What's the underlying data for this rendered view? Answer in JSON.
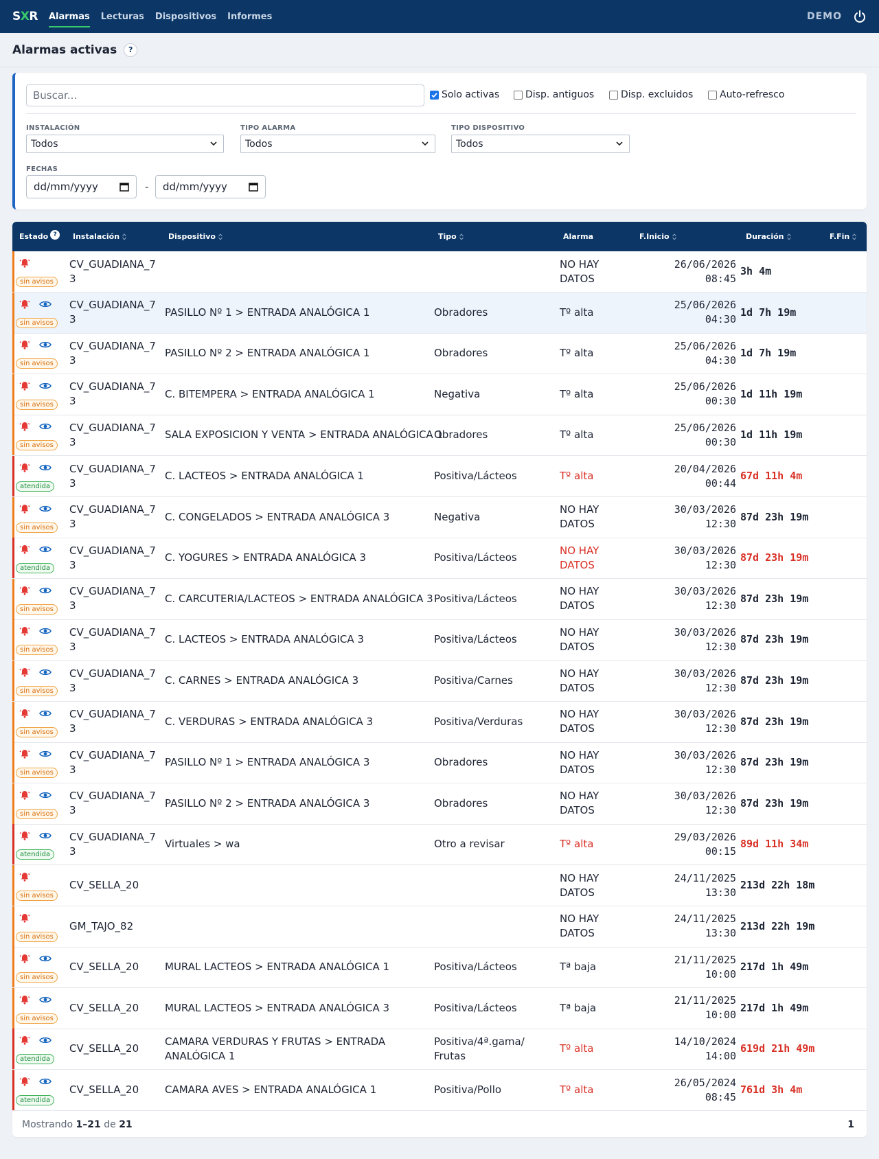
{
  "nav": {
    "logo_a": "S",
    "logo_x": "X",
    "logo_b": "R",
    "links": [
      "Alarmas",
      "Lecturas",
      "Dispositivos",
      "Informes"
    ],
    "user": "DEMO"
  },
  "page": {
    "title": "Alarmas activas",
    "help": "?"
  },
  "filters": {
    "search_placeholder": "Buscar...",
    "checkboxes": [
      {
        "label": "Solo activas",
        "checked": true
      },
      {
        "label": "Disp. antiguos",
        "checked": false
      },
      {
        "label": "Disp. excluidos",
        "checked": false
      },
      {
        "label": "Auto-refresco",
        "checked": false
      }
    ],
    "instalacion_label": "INSTALACIÓN",
    "instalacion_value": "Todos",
    "tipo_alarma_label": "TIPO ALARMA",
    "tipo_alarma_value": "Todos",
    "tipo_dispositivo_label": "TIPO DISPOSITIVO",
    "tipo_dispositivo_value": "Todos",
    "fechas_label": "FECHAS",
    "date_placeholder": "dd/mm/yyyy",
    "date_sep": "-"
  },
  "table": {
    "headers": {
      "estado": "Estado",
      "instalacion": "Instalación",
      "dispositivo": "Dispositivo",
      "tipo": "Tipo",
      "alarma": "Alarma",
      "finicio": "F.Inicio",
      "duracion": "Duración",
      "ffin": "F.Fin"
    },
    "rows": [
      {
        "status": "sin avisos",
        "eye": false,
        "inst": [
          "CV_GUADIANA_7",
          "3"
        ],
        "disp": [
          ""
        ],
        "tipo": [
          ""
        ],
        "alarma": [
          "NO HAY",
          "DATOS"
        ],
        "fecha": "26/06/2026",
        "hora": "08:45",
        "dur": "3h 4m",
        "red": false
      },
      {
        "status": "sin avisos",
        "eye": true,
        "inst": [
          "CV_GUADIANA_7",
          "3"
        ],
        "disp": [
          "PASILLO Nº 1 > ENTRADA ANALÓGICA 1"
        ],
        "tipo": [
          "Obradores"
        ],
        "alarma": [
          "Tº alta"
        ],
        "fecha": "25/06/2026",
        "hora": "04:30",
        "dur": "1d 7h 19m",
        "red": false
      },
      {
        "status": "sin avisos",
        "eye": true,
        "inst": [
          "CV_GUADIANA_7",
          "3"
        ],
        "disp": [
          "PASILLO Nº 2 > ENTRADA ANALÓGICA 1"
        ],
        "tipo": [
          "Obradores"
        ],
        "alarma": [
          "Tº alta"
        ],
        "fecha": "25/06/2026",
        "hora": "04:30",
        "dur": "1d 7h 19m",
        "red": false
      },
      {
        "status": "sin avisos",
        "eye": true,
        "inst": [
          "CV_GUADIANA_7",
          "3"
        ],
        "disp": [
          "C. BITEMPERA > ENTRADA ANALÓGICA 1"
        ],
        "tipo": [
          "Negativa"
        ],
        "alarma": [
          "Tº alta"
        ],
        "fecha": "25/06/2026",
        "hora": "00:30",
        "dur": "1d 11h 19m",
        "red": false
      },
      {
        "status": "sin avisos",
        "eye": true,
        "inst": [
          "CV_GUADIANA_7",
          "3"
        ],
        "disp": [
          "SALA EXPOSICION Y VENTA > ENTRADA ANALÓGICA 1"
        ],
        "tipo": [
          "Obradores"
        ],
        "alarma": [
          "Tº alta"
        ],
        "fecha": "25/06/2026",
        "hora": "00:30",
        "dur": "1d 11h 19m",
        "red": false
      },
      {
        "status": "atendida",
        "eye": true,
        "inst": [
          "CV_GUADIANA_7",
          "3"
        ],
        "disp": [
          "C. LACTEOS > ENTRADA ANALÓGICA 1"
        ],
        "tipo": [
          "Positiva/Lácteos"
        ],
        "alarma": [
          "Tº alta"
        ],
        "fecha": "20/04/2026",
        "hora": "00:44",
        "dur": "67d 11h 4m",
        "red": true
      },
      {
        "status": "sin avisos",
        "eye": true,
        "inst": [
          "CV_GUADIANA_7",
          "3"
        ],
        "disp": [
          "C. CONGELADOS > ENTRADA ANALÓGICA 3"
        ],
        "tipo": [
          "Negativa"
        ],
        "alarma": [
          "NO HAY",
          "DATOS"
        ],
        "fecha": "30/03/2026",
        "hora": "12:30",
        "dur": "87d 23h 19m",
        "red": false
      },
      {
        "status": "atendida",
        "eye": true,
        "inst": [
          "CV_GUADIANA_7",
          "3"
        ],
        "disp": [
          "C. YOGURES > ENTRADA ANALÓGICA 3"
        ],
        "tipo": [
          "Positiva/Lácteos"
        ],
        "alarma": [
          "NO HAY",
          "DATOS"
        ],
        "fecha": "30/03/2026",
        "hora": "12:30",
        "dur": "87d 23h 19m",
        "red": true
      },
      {
        "status": "sin avisos",
        "eye": true,
        "inst": [
          "CV_GUADIANA_7",
          "3"
        ],
        "disp": [
          "C. CARCUTERIA/LACTEOS > ENTRADA ANALÓGICA 3"
        ],
        "tipo": [
          "Positiva/Lácteos"
        ],
        "alarma": [
          "NO HAY",
          "DATOS"
        ],
        "fecha": "30/03/2026",
        "hora": "12:30",
        "dur": "87d 23h 19m",
        "red": false
      },
      {
        "status": "sin avisos",
        "eye": true,
        "inst": [
          "CV_GUADIANA_7",
          "3"
        ],
        "disp": [
          "C. LACTEOS > ENTRADA ANALÓGICA 3"
        ],
        "tipo": [
          "Positiva/Lácteos"
        ],
        "alarma": [
          "NO HAY",
          "DATOS"
        ],
        "fecha": "30/03/2026",
        "hora": "12:30",
        "dur": "87d 23h 19m",
        "red": false
      },
      {
        "status": "sin avisos",
        "eye": true,
        "inst": [
          "CV_GUADIANA_7",
          "3"
        ],
        "disp": [
          "C. CARNES > ENTRADA ANALÓGICA 3"
        ],
        "tipo": [
          "Positiva/Carnes"
        ],
        "alarma": [
          "NO HAY",
          "DATOS"
        ],
        "fecha": "30/03/2026",
        "hora": "12:30",
        "dur": "87d 23h 19m",
        "red": false
      },
      {
        "status": "sin avisos",
        "eye": true,
        "inst": [
          "CV_GUADIANA_7",
          "3"
        ],
        "disp": [
          "C. VERDURAS > ENTRADA ANALÓGICA 3"
        ],
        "tipo": [
          "Positiva/Verduras"
        ],
        "alarma": [
          "NO HAY",
          "DATOS"
        ],
        "fecha": "30/03/2026",
        "hora": "12:30",
        "dur": "87d 23h 19m",
        "red": false
      },
      {
        "status": "sin avisos",
        "eye": true,
        "inst": [
          "CV_GUADIANA_7",
          "3"
        ],
        "disp": [
          "PASILLO Nº 1 > ENTRADA ANALÓGICA 3"
        ],
        "tipo": [
          "Obradores"
        ],
        "alarma": [
          "NO HAY",
          "DATOS"
        ],
        "fecha": "30/03/2026",
        "hora": "12:30",
        "dur": "87d 23h 19m",
        "red": false
      },
      {
        "status": "sin avisos",
        "eye": true,
        "inst": [
          "CV_GUADIANA_7",
          "3"
        ],
        "disp": [
          "PASILLO Nº 2 > ENTRADA ANALÓGICA 3"
        ],
        "tipo": [
          "Obradores"
        ],
        "alarma": [
          "NO HAY",
          "DATOS"
        ],
        "fecha": "30/03/2026",
        "hora": "12:30",
        "dur": "87d 23h 19m",
        "red": false
      },
      {
        "status": "atendida",
        "eye": true,
        "inst": [
          "CV_GUADIANA_7",
          "3"
        ],
        "disp": [
          "Virtuales > wa"
        ],
        "tipo": [
          "Otro a revisar"
        ],
        "alarma": [
          "Tº alta"
        ],
        "fecha": "29/03/2026",
        "hora": "00:15",
        "dur": "89d 11h 34m",
        "red": true
      },
      {
        "status": "sin avisos",
        "eye": false,
        "inst": [
          "CV_SELLA_20"
        ],
        "disp": [
          ""
        ],
        "tipo": [
          ""
        ],
        "alarma": [
          "NO HAY",
          "DATOS"
        ],
        "fecha": "24/11/2025",
        "hora": "13:30",
        "dur": "213d 22h 18m",
        "red": false
      },
      {
        "status": "sin avisos",
        "eye": false,
        "inst": [
          "GM_TAJO_82"
        ],
        "disp": [
          ""
        ],
        "tipo": [
          ""
        ],
        "alarma": [
          "NO HAY",
          "DATOS"
        ],
        "fecha": "24/11/2025",
        "hora": "13:30",
        "dur": "213d 22h 19m",
        "red": false
      },
      {
        "status": "sin avisos",
        "eye": true,
        "inst": [
          "CV_SELLA_20"
        ],
        "disp": [
          "MURAL LACTEOS > ENTRADA ANALÓGICA 1"
        ],
        "tipo": [
          "Positiva/Lácteos"
        ],
        "alarma": [
          "Tª baja"
        ],
        "fecha": "21/11/2025",
        "hora": "10:00",
        "dur": "217d 1h 49m",
        "red": false
      },
      {
        "status": "sin avisos",
        "eye": true,
        "inst": [
          "CV_SELLA_20"
        ],
        "disp": [
          "MURAL LACTEOS > ENTRADA ANALÓGICA 3"
        ],
        "tipo": [
          "Positiva/Lácteos"
        ],
        "alarma": [
          "Tª baja"
        ],
        "fecha": "21/11/2025",
        "hora": "10:00",
        "dur": "217d 1h 49m",
        "red": false
      },
      {
        "status": "atendida",
        "eye": true,
        "inst": [
          "CV_SELLA_20"
        ],
        "disp": [
          "CAMARA VERDURAS Y FRUTAS > ENTRADA",
          "ANALÓGICA 1"
        ],
        "tipo": [
          "Positiva/4ª.gama/",
          "Frutas"
        ],
        "alarma": [
          "Tº alta"
        ],
        "fecha": "14/10/2024",
        "hora": "14:00",
        "dur": "619d 21h 49m",
        "red": true
      },
      {
        "status": "atendida",
        "eye": true,
        "inst": [
          "CV_SELLA_20"
        ],
        "disp": [
          "CAMARA AVES > ENTRADA ANALÓGICA 1"
        ],
        "tipo": [
          "Positiva/Pollo"
        ],
        "alarma": [
          "Tº alta"
        ],
        "fecha": "26/05/2024",
        "hora": "08:45",
        "dur": "761d 3h 4m",
        "red": true
      }
    ]
  },
  "footer": {
    "prefix": "Mostrando",
    "range": "1–21",
    "de": "de",
    "total": "21",
    "page": "1"
  },
  "colors": {
    "navbar": "#0b3666",
    "accent_green": "#39c96d",
    "alarm_red": "#d93025",
    "warning_orange": "#ef7d1a",
    "ok_green": "#1e8e3e"
  }
}
